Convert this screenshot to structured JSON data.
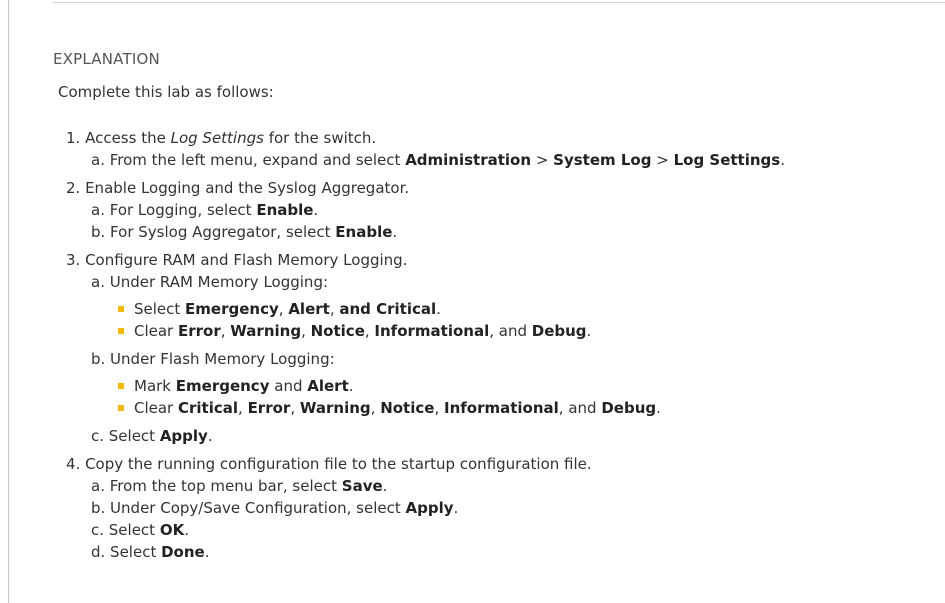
{
  "heading": "EXPLANATION",
  "intro": "Complete this lab as follows:",
  "steps": {
    "s1": {
      "pre": "1. Access the ",
      "em": "Log Settings",
      "post": " for the switch.",
      "a": {
        "pre": "a. From the left menu, expand and select ",
        "b1": "Administration",
        "sep1": " > ",
        "b2": "System Log",
        "sep2": " > ",
        "b3": "Log Settings",
        "post": "."
      }
    },
    "s2": {
      "text": "2. Enable Logging and the Syslog Aggregator.",
      "a": {
        "pre": "a. For Logging, select ",
        "b": "Enable",
        "post": "."
      },
      "b": {
        "pre": "b. For Syslog Aggregator, select ",
        "b": "Enable",
        "post": "."
      }
    },
    "s3": {
      "text": "3. Configure RAM and Flash Memory Logging.",
      "a": {
        "text": "a. Under RAM Memory Logging:",
        "bullet1": {
          "pre": "Select ",
          "b1": "Emergency",
          "sep1": ", ",
          "b2": "Alert",
          "sep2": ", ",
          "b3": "and Critical",
          "post": "."
        },
        "bullet2": {
          "pre": "Clear ",
          "b1": "Error",
          "sep1": ", ",
          "b2": "Warning",
          "sep2": ", ",
          "b3": "Notice",
          "sep3": ", ",
          "b4": "Informational",
          "sep4": ", and ",
          "b5": "Debug",
          "post": "."
        }
      },
      "b": {
        "text": "b. Under Flash Memory Logging:",
        "bullet1": {
          "pre": "Mark ",
          "b1": "Emergency",
          "sep1": " and ",
          "b2": "Alert",
          "post": "."
        },
        "bullet2": {
          "pre": "Clear ",
          "b1": "Critical",
          "sep1": ", ",
          "b2": "Error",
          "sep2": ", ",
          "b3": "Warning",
          "sep3": ", ",
          "b4": "Notice",
          "sep4": ", ",
          "b5": "Informational",
          "sep5": ", and ",
          "b6": "Debug",
          "post": "."
        }
      },
      "c": {
        "pre": "c. Select ",
        "b": "Apply",
        "post": "."
      }
    },
    "s4": {
      "text": "4. Copy the running configuration file to the startup configuration file.",
      "a": {
        "pre": "a. From the top menu bar, select ",
        "b": "Save",
        "post": "."
      },
      "b": {
        "pre": "b. Under Copy/Save Configuration, select ",
        "b": "Apply",
        "post": "."
      },
      "c": {
        "pre": "c. Select ",
        "b": "OK",
        "post": "."
      },
      "d": {
        "pre": "d. Select ",
        "b": "Done",
        "post": "."
      }
    }
  },
  "colors": {
    "bullet": "#f5b800",
    "heading": "#555555",
    "text": "#333333"
  }
}
